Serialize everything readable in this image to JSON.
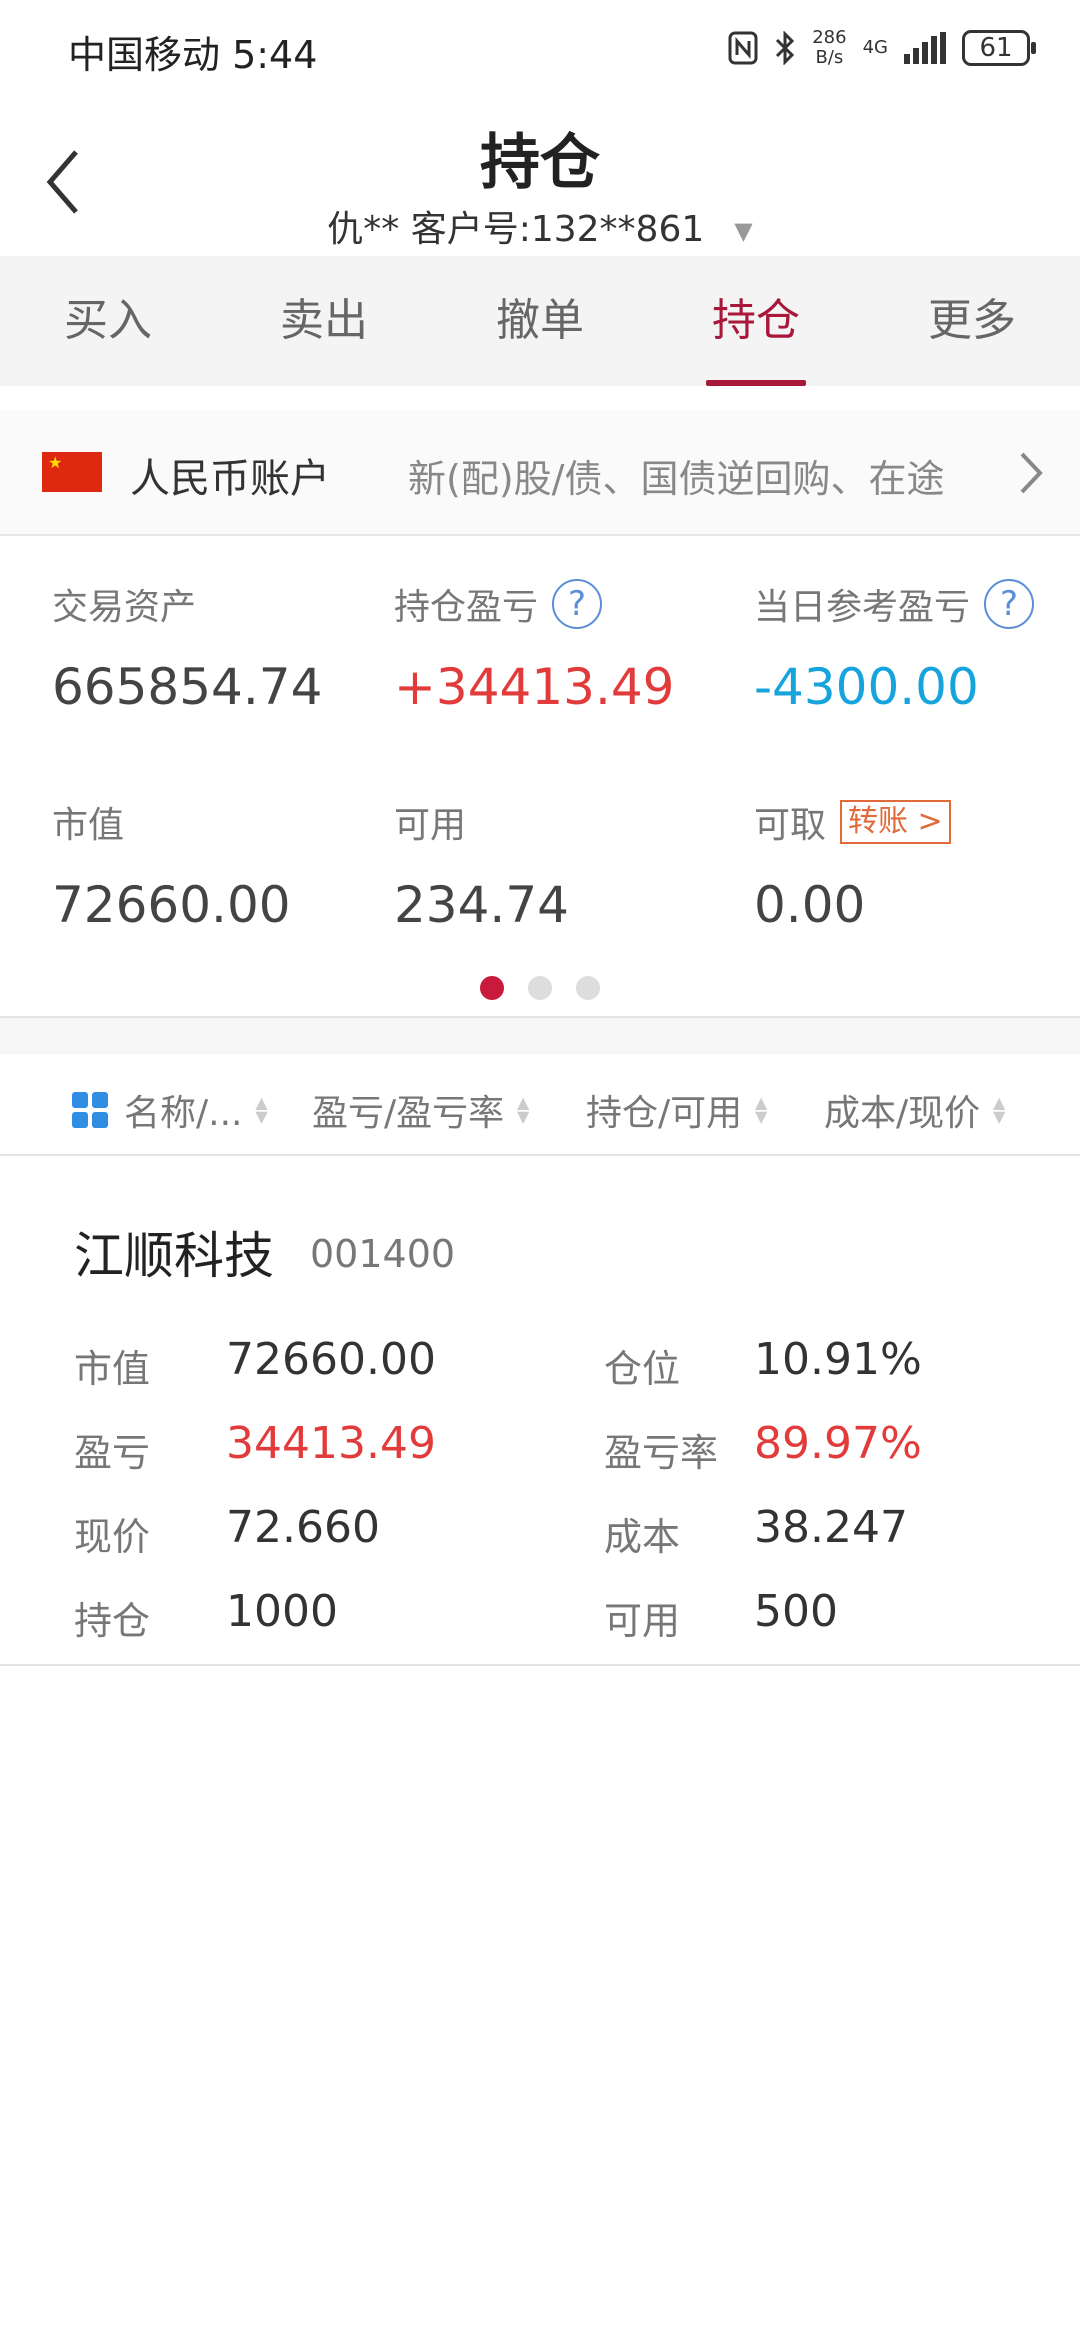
{
  "status_bar": {
    "carrier_time": "中国移动 5:44",
    "speed": "286\nB/s",
    "speed_top": "286",
    "speed_bottom": "B/s",
    "network": "4G",
    "battery": "61",
    "icons": [
      "nfc-icon",
      "bluetooth-icon",
      "signal-icon",
      "battery-icon"
    ]
  },
  "header": {
    "title": "持仓",
    "account_info": "仇**  客户号:132**861",
    "back_icon": "chevron-left-icon"
  },
  "tabs": [
    {
      "label": "买入",
      "active": false
    },
    {
      "label": "卖出",
      "active": false
    },
    {
      "label": "撤单",
      "active": false
    },
    {
      "label": "持仓",
      "active": true
    },
    {
      "label": "更多",
      "active": false
    }
  ],
  "account": {
    "flag_icon": "china-flag-icon",
    "name": "人民币账户",
    "description": "新(配)股/债、国债逆回购、在途"
  },
  "stats": {
    "trade_assets": {
      "label": "交易资产",
      "value": "665854.74"
    },
    "position_pl": {
      "label": "持仓盈亏",
      "value": "+34413.49"
    },
    "daily_pl": {
      "label": "当日参考盈亏",
      "value": "-4300.00"
    },
    "market_value": {
      "label": "市值",
      "value": "72660.00"
    },
    "available": {
      "label": "可用",
      "value": "234.74"
    },
    "withdrawable": {
      "label": "可取",
      "value": "0.00",
      "transfer_label": "转账 >"
    }
  },
  "pager": {
    "count": 3,
    "active": 0
  },
  "table_header": {
    "name": "名称/...",
    "pl": "盈亏/盈亏率",
    "holding": "持仓/可用",
    "cost": "成本/现价"
  },
  "positions": [
    {
      "name": "江顺科技",
      "code": "001400",
      "market_value_label": "市值",
      "market_value": "72660.00",
      "weight_label": "仓位",
      "weight": "10.91%",
      "pl_label": "盈亏",
      "pl": "34413.49",
      "pl_rate_label": "盈亏率",
      "pl_rate": "89.97%",
      "price_label": "现价",
      "price": "72.660",
      "cost_label": "成本",
      "cost": "38.247",
      "holding_label": "持仓",
      "holding": "1000",
      "available_label": "可用",
      "available": "500"
    }
  ],
  "colors": {
    "accent": "#a8183a",
    "profit": "#e23b3b",
    "loss": "#17a4dd",
    "link_blue": "#2f8de4"
  }
}
